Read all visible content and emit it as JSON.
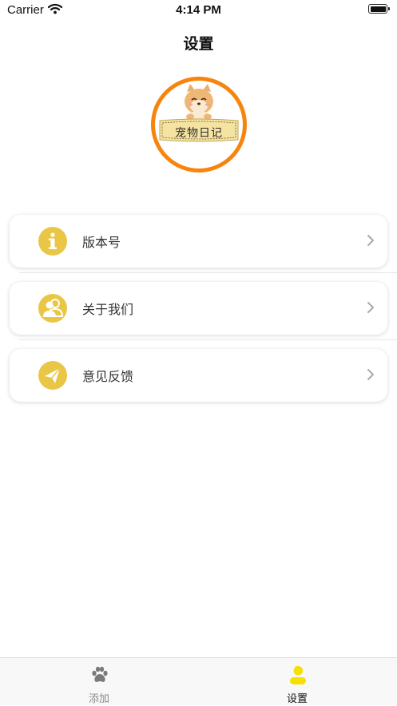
{
  "status_bar": {
    "carrier": "Carrier",
    "time": "4:14 PM"
  },
  "nav": {
    "title": "设置"
  },
  "logo": {
    "text": "宠物日记"
  },
  "menu": [
    {
      "label": "版本号",
      "icon": "info-icon"
    },
    {
      "label": "关于我们",
      "icon": "users-icon"
    },
    {
      "label": "意见反馈",
      "icon": "send-icon"
    }
  ],
  "tabs": [
    {
      "label": "添加",
      "icon": "paw-icon",
      "active": false
    },
    {
      "label": "设置",
      "icon": "person-icon",
      "active": true
    }
  ],
  "colors": {
    "accent": "#e9c646",
    "logo_ring": "#f7850d",
    "tab_active_icon": "#f5e000",
    "tab_inactive": "#8a8a8a"
  }
}
